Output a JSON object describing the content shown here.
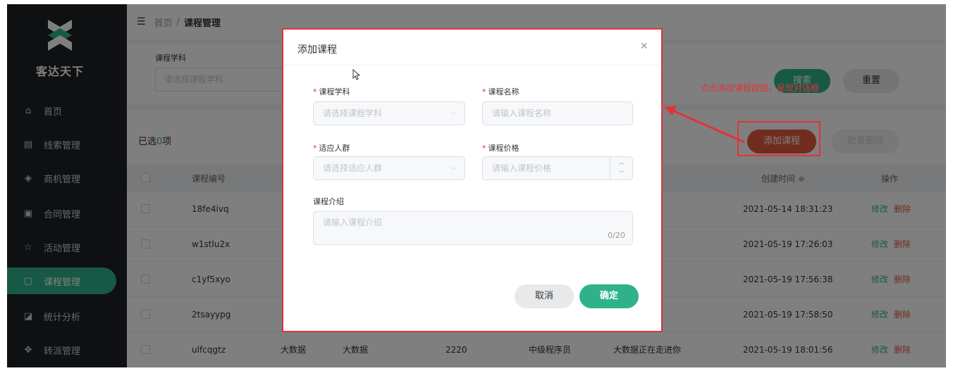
{
  "sidebar": {
    "brand": "客达天下",
    "items": [
      {
        "label": "首页",
        "icon": "home-icon"
      },
      {
        "label": "线索管理",
        "icon": "clue-icon"
      },
      {
        "label": "商机管理",
        "icon": "target-icon"
      },
      {
        "label": "合同管理",
        "icon": "document-icon"
      },
      {
        "label": "活动管理",
        "icon": "star-icon"
      },
      {
        "label": "课程管理",
        "icon": "course-icon",
        "active": true
      },
      {
        "label": "统计分析",
        "icon": "chart-icon"
      },
      {
        "label": "转派管理",
        "icon": "transfer-icon"
      }
    ]
  },
  "breadcrumb": {
    "home": "首页",
    "separator": "/",
    "current": "课程管理"
  },
  "filter": {
    "subject_label": "课程学科",
    "subject_placeholder": "请选择课程学科",
    "search_label": "搜索",
    "reset_label": "重置"
  },
  "toolbar": {
    "selected_prefix": "已选",
    "selected_count": "0",
    "selected_suffix": "项",
    "add_label": "添加课程",
    "batch_delete_label": "批量删除"
  },
  "table": {
    "headers": {
      "code": "课程编号",
      "created": "创建时间 ≑",
      "ops": "操作"
    },
    "rows": [
      {
        "code": "18fe4ivq",
        "created": "2021-05-14 18:31:23"
      },
      {
        "code": "w1stlu2x",
        "created": "2021-05-19 17:26:03"
      },
      {
        "code": "c1yf5xyo",
        "created": "2021-05-19 17:56:38"
      },
      {
        "code": "2tsayypg",
        "created": "2021-05-19 17:58:50"
      },
      {
        "code": "ulfcqgtz",
        "subject": "大数据",
        "name": "大数据",
        "price": "2220",
        "crowd": "中级程序员",
        "intro": "大数据正在走进你",
        "created": "2021-05-19 18:01:56"
      }
    ],
    "edit_label": "修改",
    "delete_label": "删除"
  },
  "dialog": {
    "title": "添加课程",
    "subject_label": "课程学科",
    "subject_placeholder": "请选择课程学科",
    "name_label": "课程名称",
    "name_placeholder": "请输入课程名称",
    "crowd_label": "适应人群",
    "crowd_placeholder": "请选择适应人群",
    "price_label": "课程价格",
    "price_placeholder": "请输入课程价格",
    "intro_label": "课程介绍",
    "intro_placeholder": "请输入课程介绍",
    "intro_counter": "0/20",
    "cancel_label": "取消",
    "confirm_label": "确定"
  },
  "annotation": {
    "text": "点击添加课程按钮，呈现对话框"
  },
  "colors": {
    "accent": "#2fb28a",
    "danger": "#e05b3e",
    "annotation": "#e0333a",
    "sidebar_bg": "#1d2125"
  }
}
